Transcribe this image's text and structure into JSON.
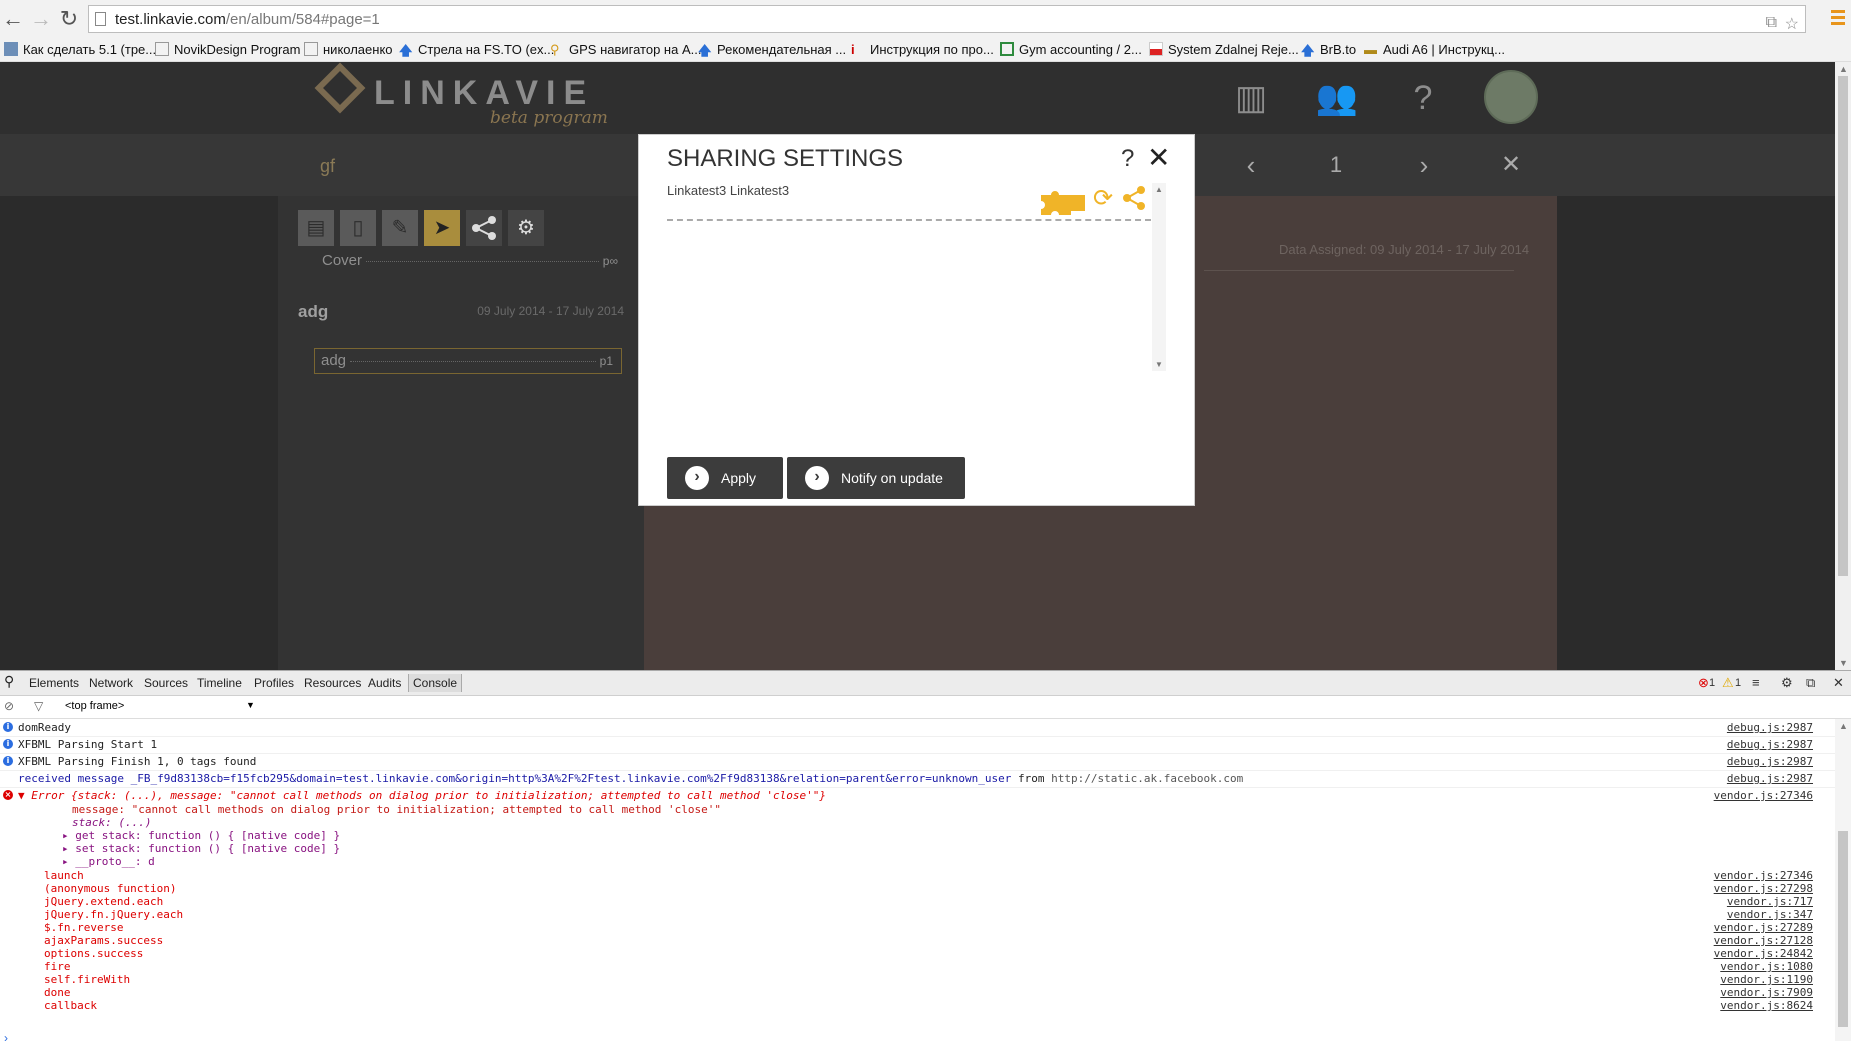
{
  "browser": {
    "url_host": "test.linkavie.com",
    "url_path": "/en/album/584#page=1",
    "bookmarks": [
      "Как сделать 5.1 (тре...",
      "NovikDesign Program",
      "николаенко",
      "Стрела на FS.TO (ex...",
      "GPS навигатор на A...",
      "Рекомендательная ...",
      "Инструкция по про...",
      "Gym accounting / 2...",
      "System Zdalnej Reje...",
      "BrB.to",
      "Audi A6 | Инструкц..."
    ]
  },
  "header": {
    "logo_text": "LINKAVIE",
    "logo_tagline": "beta program",
    "help_label": "?"
  },
  "subbar": {
    "album_title": "gf",
    "page_number": "1"
  },
  "left_panel": {
    "cover_label": "Cover",
    "cover_page": "p∞",
    "section_title": "adg",
    "section_date": "09 July 2014 - 17 July 2014",
    "page_item_label": "adg",
    "page_item_page": "p1"
  },
  "content": {
    "assigned_text": "Data Assigned: 09 July 2014 - 17 July 2014"
  },
  "modal": {
    "title": "SHARING SETTINGS",
    "help": "?",
    "close": "✕",
    "share_entry": "Linkatest3 Linkatest3",
    "apply_label": "Apply",
    "notify_label": "Notify on update"
  },
  "devtools": {
    "tabs": [
      "Elements",
      "Network",
      "Sources",
      "Timeline",
      "Profiles",
      "Resources",
      "Audits",
      "Console"
    ],
    "error_count": "1",
    "warning_count": "1",
    "frame": "<top frame>",
    "logs": [
      {
        "text": "domReady",
        "source": "debug.js:2987"
      },
      {
        "text": "XFBML Parsing Start 1",
        "source": "debug.js:2987"
      },
      {
        "text": "XFBML Parsing Finish 1, 0 tags found",
        "source": "debug.js:2987"
      },
      {
        "text": "received message _FB_f9d83138cb=f15fcb295&domain=test.linkavie.com&origin=http%3A%2F%2Ftest.linkavie.com%2Ff9d83138&relation=parent&error=unknown_user",
        "from": "from",
        "from_url": "http://static.ak.facebook.com",
        "source": "debug.js:2987"
      }
    ],
    "error": {
      "summary": "Error {stack: (...), message: \"cannot call methods on dialog prior to initialization; attempted to call method 'close'\"}",
      "source": "vendor.js:27346",
      "message_line": "message: \"cannot call methods on dialog prior to initialization; attempted to call method 'close'\"",
      "stack_line": "stack: (...)",
      "get_stack": "get stack: function () { [native code] }",
      "set_stack": "set stack: function () { [native code] }",
      "proto": "__proto__: d",
      "trace": [
        {
          "fn": "launch",
          "src": "vendor.js:27346"
        },
        {
          "fn": "(anonymous function)",
          "src": "vendor.js:27298"
        },
        {
          "fn": "jQuery.extend.each",
          "src": "vendor.js:717"
        },
        {
          "fn": "jQuery.fn.jQuery.each",
          "src": "vendor.js:347"
        },
        {
          "fn": "$.fn.reverse",
          "src": "vendor.js:27289"
        },
        {
          "fn": "ajaxParams.success",
          "src": "vendor.js:27128"
        },
        {
          "fn": "options.success",
          "src": "vendor.js:24842"
        },
        {
          "fn": "fire",
          "src": "vendor.js:1080"
        },
        {
          "fn": "self.fireWith",
          "src": "vendor.js:1190"
        },
        {
          "fn": "done",
          "src": "vendor.js:7909"
        },
        {
          "fn": "callback",
          "src": "vendor.js:8624"
        }
      ]
    }
  }
}
